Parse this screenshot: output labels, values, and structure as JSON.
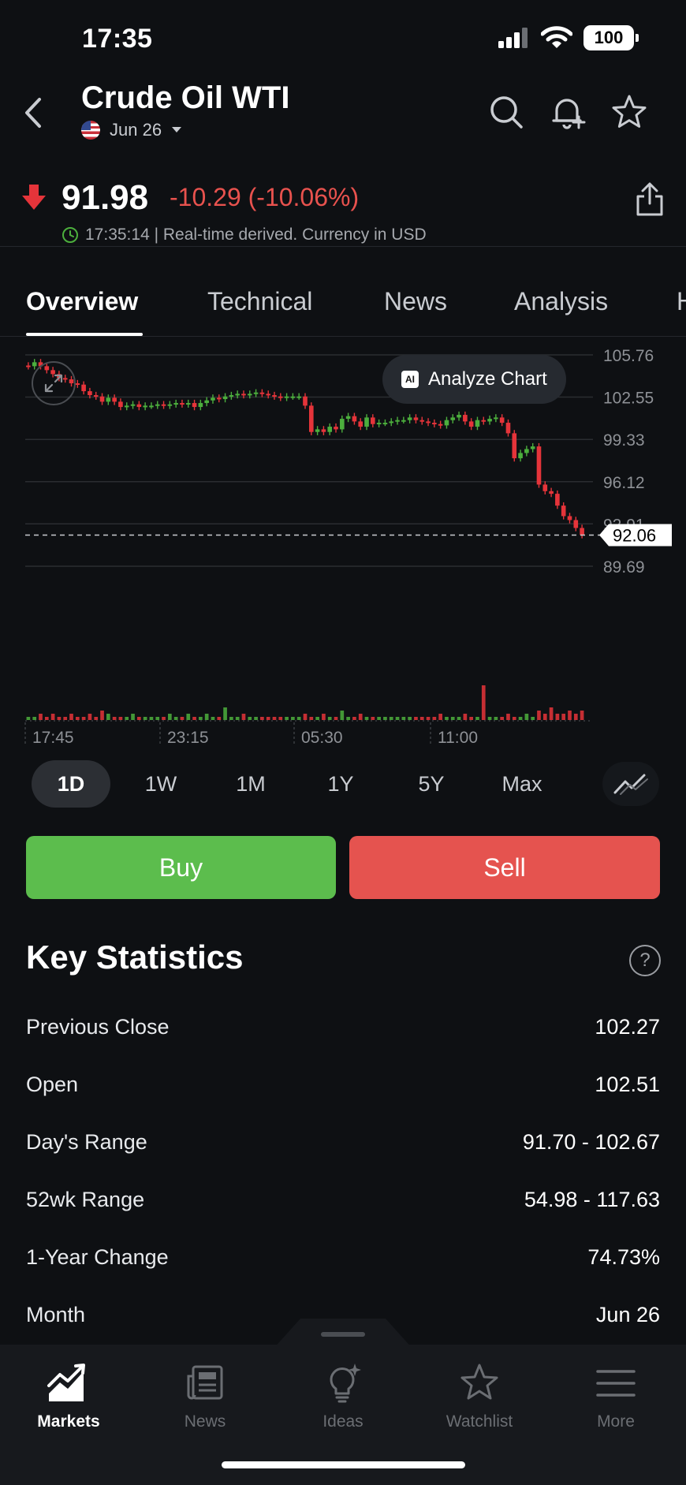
{
  "status_bar": {
    "time": "17:35",
    "battery": "100"
  },
  "header": {
    "title": "Crude Oil WTI",
    "contract": "Jun 26"
  },
  "quote": {
    "price": "91.98",
    "change": "-10.29 (-10.06%)",
    "timestamp": "17:35:14 | Real-time derived. Currency in USD"
  },
  "tabs": [
    {
      "label": "Overview",
      "active": true
    },
    {
      "label": "Technical"
    },
    {
      "label": "News"
    },
    {
      "label": "Analysis"
    },
    {
      "label": "H"
    }
  ],
  "chart_toolbar": {
    "analyze_label": "Analyze Chart",
    "ai_badge": "AI"
  },
  "chart_data": {
    "type": "candlestick",
    "y_ticks": [
      "105.76",
      "102.55",
      "99.33",
      "96.12",
      "92.91",
      "89.69"
    ],
    "ylim": [
      89.69,
      105.76
    ],
    "x_ticks": [
      "17:45",
      "23:15",
      "05:30",
      "11:00"
    ],
    "current_price": 92.06,
    "current_price_label": "92.06",
    "colors": {
      "up": "#4caf3d",
      "down": "#e5343a",
      "grid": "#2a2d31",
      "axis_text": "#8e9196"
    },
    "close_series": [
      104.9,
      105.2,
      104.9,
      104.6,
      104.3,
      104.0,
      103.9,
      103.6,
      103.5,
      103.0,
      102.7,
      102.6,
      102.2,
      102.5,
      102.2,
      101.8,
      101.9,
      102.0,
      101.8,
      101.9,
      101.9,
      102.0,
      101.9,
      102.0,
      102.1,
      102.0,
      102.1,
      101.8,
      102.1,
      102.3,
      102.5,
      102.4,
      102.6,
      102.7,
      102.8,
      102.7,
      102.8,
      102.9,
      102.8,
      102.7,
      102.6,
      102.5,
      102.6,
      102.6,
      102.6,
      101.9,
      99.9,
      100.1,
      99.9,
      100.3,
      100.1,
      100.9,
      101.1,
      100.7,
      100.3,
      101.0,
      100.5,
      100.6,
      100.6,
      100.7,
      100.8,
      100.8,
      101.0,
      100.8,
      100.7,
      100.6,
      100.5,
      100.4,
      100.8,
      101.0,
      101.2,
      100.7,
      100.3,
      100.8,
      100.7,
      100.9,
      101.0,
      100.6,
      99.8,
      97.9,
      98.3,
      98.6,
      98.8,
      95.9,
      95.4,
      95.2,
      94.3,
      93.5,
      93.2,
      92.6,
      92.06
    ],
    "volume_series": [
      1,
      1,
      2,
      1,
      2,
      1,
      1,
      2,
      1,
      1,
      2,
      1,
      3,
      2,
      1,
      1,
      1,
      2,
      1,
      1,
      1,
      1,
      1,
      2,
      1,
      1,
      2,
      1,
      1,
      2,
      1,
      1,
      4,
      1,
      1,
      2,
      1,
      1,
      1,
      1,
      1,
      1,
      1,
      1,
      1,
      2,
      1,
      1,
      2,
      1,
      1,
      3,
      1,
      1,
      2,
      1,
      1,
      1,
      1,
      1,
      1,
      1,
      1,
      1,
      1,
      1,
      1,
      2,
      1,
      1,
      1,
      2,
      1,
      1,
      11,
      1,
      1,
      1,
      2,
      1,
      1,
      2,
      1,
      3,
      2,
      4,
      2,
      2,
      3,
      2,
      3
    ]
  },
  "ranges": [
    {
      "label": "1D",
      "active": true
    },
    {
      "label": "1W"
    },
    {
      "label": "1M"
    },
    {
      "label": "1Y"
    },
    {
      "label": "5Y"
    },
    {
      "label": "Max"
    }
  ],
  "actions": {
    "buy": "Buy",
    "sell": "Sell"
  },
  "key_statistics": {
    "title": "Key Statistics",
    "help": "?",
    "rows": [
      {
        "label": "Previous Close",
        "value": "102.27"
      },
      {
        "label": "Open",
        "value": "102.51"
      },
      {
        "label": "Day's Range",
        "value": "91.70 - 102.67"
      },
      {
        "label": "52wk Range",
        "value": "54.98 - 117.63"
      },
      {
        "label": "1-Year Change",
        "value": "74.73%"
      },
      {
        "label": "Month",
        "value": "Jun 26"
      }
    ]
  },
  "bottom_nav": [
    {
      "label": "Markets",
      "icon": "markets-chart-icon",
      "active": true
    },
    {
      "label": "News",
      "icon": "newspaper-icon"
    },
    {
      "label": "Ideas",
      "icon": "lightbulb-icon"
    },
    {
      "label": "Watchlist",
      "icon": "star-icon"
    },
    {
      "label": "More",
      "icon": "menu-icon"
    }
  ]
}
